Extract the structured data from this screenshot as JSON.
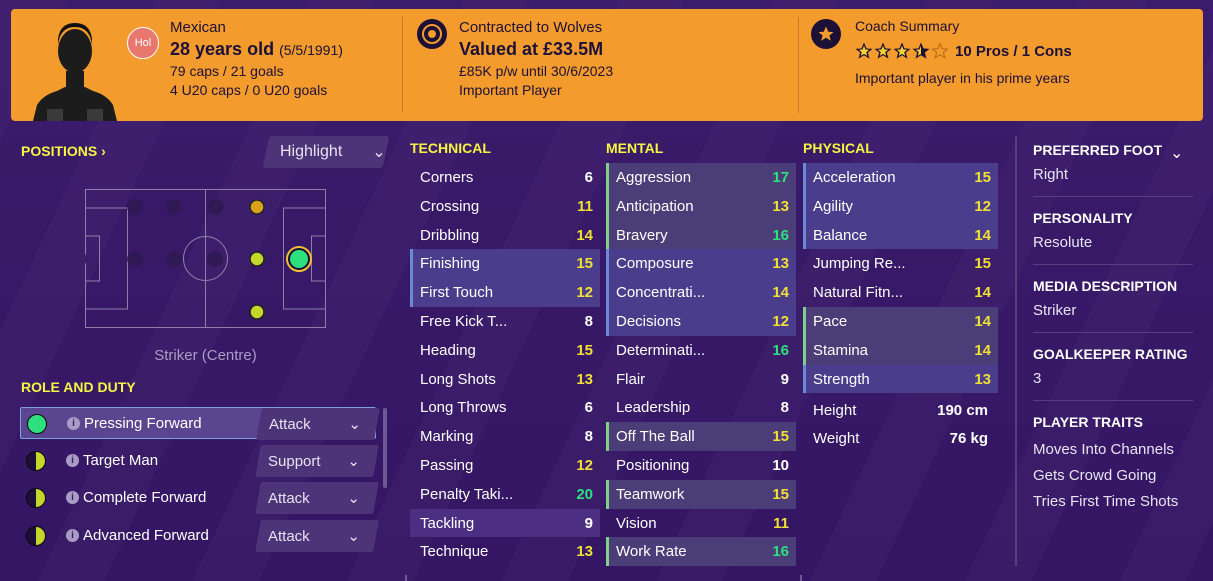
{
  "banner": {
    "flag_code": "Hol",
    "nationality": "Mexican",
    "age": "28 years old",
    "dob": "(5/5/1991)",
    "caps": "79 caps / 21 goals",
    "u20_caps": "4 U20 caps / 0 U20 goals",
    "club": "Contracted to Wolves",
    "value": "Valued at £33.5M",
    "wage": "£85K p/w until 30/6/2023",
    "squad_status": "Important Player",
    "coach_title": "Coach Summary",
    "coach_stars": 3.5,
    "pros_cons": "10 Pros / 1 Cons",
    "coach_comment": "Important player in his prime years"
  },
  "positions": {
    "title": "POSITIONS",
    "highlight_label": "Highlight",
    "pitch_label": "Striker (Centre)"
  },
  "roles": {
    "title": "ROLE AND DUTY",
    "items": [
      {
        "name": "Pressing Forward",
        "duty": "Attack"
      },
      {
        "name": "Target Man",
        "duty": "Support"
      },
      {
        "name": "Complete Forward",
        "duty": "Attack"
      },
      {
        "name": "Advanced Forward",
        "duty": "Attack"
      }
    ]
  },
  "technical": {
    "title": "TECHNICAL",
    "rows": [
      {
        "name": "Corners",
        "value": "6"
      },
      {
        "name": "Crossing",
        "value": "11"
      },
      {
        "name": "Dribbling",
        "value": "14"
      },
      {
        "name": "Finishing",
        "value": "15"
      },
      {
        "name": "First Touch",
        "value": "12"
      },
      {
        "name": "Free Kick T...",
        "value": "8"
      },
      {
        "name": "Heading",
        "value": "15"
      },
      {
        "name": "Long Shots",
        "value": "13"
      },
      {
        "name": "Long Throws",
        "value": "6"
      },
      {
        "name": "Marking",
        "value": "8"
      },
      {
        "name": "Passing",
        "value": "12"
      },
      {
        "name": "Penalty Taki...",
        "value": "20"
      },
      {
        "name": "Tackling",
        "value": "9"
      },
      {
        "name": "Technique",
        "value": "13"
      }
    ]
  },
  "mental": {
    "title": "MENTAL",
    "rows": [
      {
        "name": "Aggression",
        "value": "17"
      },
      {
        "name": "Anticipation",
        "value": "13"
      },
      {
        "name": "Bravery",
        "value": "16"
      },
      {
        "name": "Composure",
        "value": "13"
      },
      {
        "name": "Concentrati...",
        "value": "14"
      },
      {
        "name": "Decisions",
        "value": "12"
      },
      {
        "name": "Determinati...",
        "value": "16"
      },
      {
        "name": "Flair",
        "value": "9"
      },
      {
        "name": "Leadership",
        "value": "8"
      },
      {
        "name": "Off The Ball",
        "value": "15"
      },
      {
        "name": "Positioning",
        "value": "10"
      },
      {
        "name": "Teamwork",
        "value": "15"
      },
      {
        "name": "Vision",
        "value": "11"
      },
      {
        "name": "Work Rate",
        "value": "16"
      }
    ]
  },
  "physical": {
    "title": "PHYSICAL",
    "rows": [
      {
        "name": "Acceleration",
        "value": "15"
      },
      {
        "name": "Agility",
        "value": "12"
      },
      {
        "name": "Balance",
        "value": "14"
      },
      {
        "name": "Jumping Re...",
        "value": "15"
      },
      {
        "name": "Natural Fitn...",
        "value": "14"
      },
      {
        "name": "Pace",
        "value": "14"
      },
      {
        "name": "Stamina",
        "value": "14"
      },
      {
        "name": "Strength",
        "value": "13"
      }
    ],
    "height_label": "Height",
    "height_value": "190 cm",
    "weight_label": "Weight",
    "weight_value": "76 kg"
  },
  "info": {
    "foot_label": "PREFERRED FOOT",
    "foot_value": "Right",
    "personality_label": "PERSONALITY",
    "personality_value": "Resolute",
    "media_label": "MEDIA DESCRIPTION",
    "media_value": "Striker",
    "gk_label": "GOALKEEPER RATING",
    "gk_value": "3",
    "traits_label": "PLAYER TRAITS",
    "traits": [
      "Moves Into Channels",
      "Gets Crowd Going",
      "Tries First Time Shots"
    ]
  },
  "colors": {
    "banner": "#f39b2d",
    "background": "#3a1a6a",
    "heading_yellow": "#f5f542",
    "value_green": "#2de07e",
    "value_yellow": "#f0e035"
  }
}
